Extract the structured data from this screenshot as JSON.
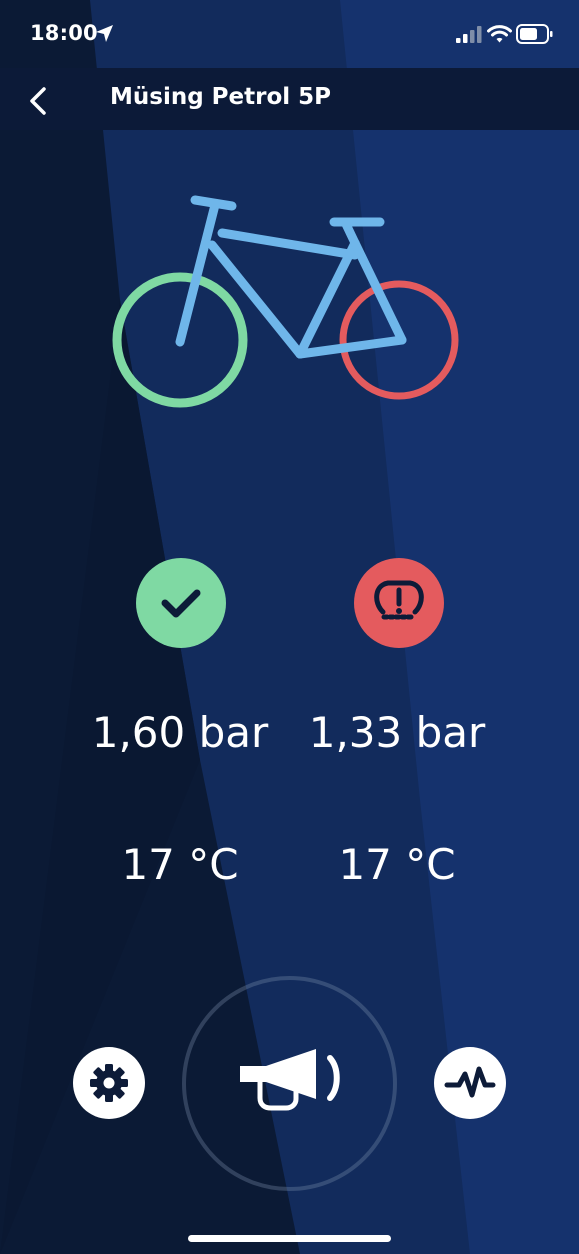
{
  "status_bar": {
    "time": "18:00",
    "icons": [
      "location-arrow-icon",
      "signal-icon",
      "wifi-icon",
      "battery-icon"
    ]
  },
  "nav": {
    "back_icon": "chevron-left-icon",
    "title": "Müsing Petrol 5P"
  },
  "bike": {
    "front_wheel_status": "ok",
    "rear_wheel_status": "alert",
    "colors": {
      "frame": "#6fb6ea",
      "ok": "#7fd9a3",
      "alert": "#e45b5e"
    }
  },
  "front_tire": {
    "status_icon": "checkmark-icon",
    "pressure": "1,60 bar",
    "temperature": "17 °C"
  },
  "rear_tire": {
    "status_icon": "tire-pressure-warning-icon",
    "pressure": "1,33 bar",
    "temperature": "17 °C"
  },
  "actions": {
    "settings_icon": "gear-icon",
    "horn_icon": "horn-icon",
    "stats_icon": "activity-graph-icon"
  },
  "theme": {
    "background_dark": "#0b1a35",
    "background_light": "#143068",
    "nav_bar": "#0c1a38"
  }
}
